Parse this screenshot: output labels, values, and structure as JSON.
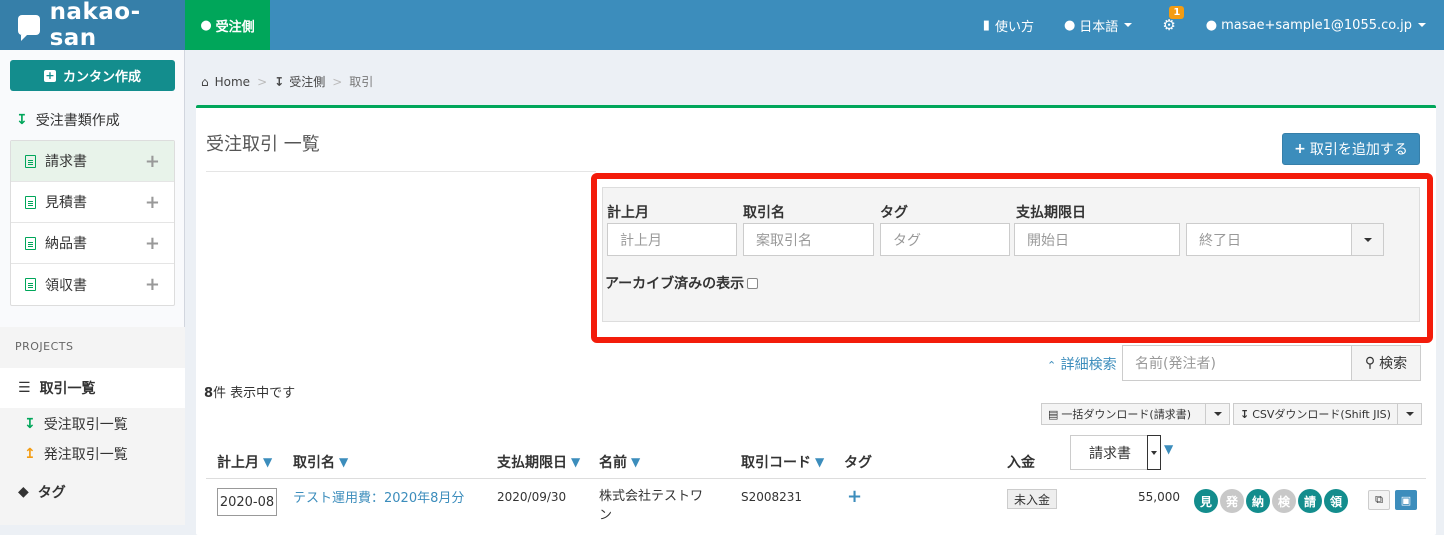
{
  "header": {
    "logo_text": "nakao-san",
    "role_tab": "受注側",
    "help": "使い方",
    "language": "日本語",
    "notification_count": "1",
    "user": "masae+sample1@1055.co.jp"
  },
  "sidebar": {
    "create_button": "カンタン作成",
    "docs_heading": "受注書類作成",
    "doc_items": [
      {
        "label": "請求書"
      },
      {
        "label": "見積書"
      },
      {
        "label": "納品書"
      },
      {
        "label": "領収書"
      }
    ],
    "projects_label": "PROJECTS",
    "active_item": "取引一覧",
    "sub_items": [
      {
        "label": "受注取引一覧"
      },
      {
        "label": "発注取引一覧"
      }
    ],
    "tag_item": "タグ"
  },
  "breadcrumb": {
    "home": "Home",
    "section": "受注側",
    "current": "取引"
  },
  "main": {
    "title": "受注取引 一覧",
    "add_button": "取引を追加する",
    "filters": {
      "month_label": "計上月",
      "month_placeholder": "計上月",
      "name_label": "取引名",
      "name_placeholder": "案取引名",
      "tag_label": "タグ",
      "tag_placeholder": "タグ",
      "due_label": "支払期限日",
      "start_placeholder": "開始日",
      "end_placeholder": "終了日",
      "archive_label": "アーカイブ済みの表示"
    },
    "advanced_search": "詳細検索",
    "search_placeholder": "名前(発注者)",
    "search_button": "検索",
    "count_number": "8",
    "count_text": "件 表示中です",
    "bulk_download": "一括ダウンロード(請求書)",
    "csv_download": "CSVダウンロード(Shift JIS)",
    "columns": {
      "month": "計上月",
      "name": "取引名",
      "due": "支払期限日",
      "customer": "名前",
      "code": "取引コード",
      "tag": "タグ",
      "payment": "入金",
      "doc_type": "請求書"
    },
    "rows": [
      {
        "month": "2020-08",
        "name": "テスト運用費：2020年8月分",
        "due": "2020/09/30",
        "customer_line1": "株式会社テストワ",
        "customer_line2": "ン",
        "code": "S2008231",
        "status": "未入金",
        "amount": "55,000",
        "doc_badges": [
          "見",
          "発",
          "納",
          "検",
          "請",
          "領"
        ]
      }
    ]
  },
  "colors": {
    "header_blue": "#3c8dbc",
    "role_green": "#00a65a",
    "teal_badge": "#138d8d",
    "gray_badge": "#c8c8c8",
    "highlight_red": "#f31c0b"
  }
}
